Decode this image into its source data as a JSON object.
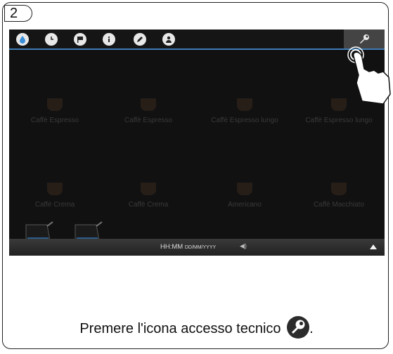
{
  "step": "2",
  "topbar": {
    "icons": [
      "water-drop-icon",
      "clock-icon",
      "flag-icon",
      "info-icon",
      "pencil-icon",
      "user-icon"
    ],
    "settings_icon": "wrench-icon",
    "accent_color": "#3e7fb8"
  },
  "drinks": [
    {
      "label": "Caffè Espresso"
    },
    {
      "label": "Caffè Espresso"
    },
    {
      "label": "Caffè Espresso lungo"
    },
    {
      "label": "Caffè Espresso lungo"
    },
    {
      "label": "Caffè Crema"
    },
    {
      "label": "Caffè Crema"
    },
    {
      "label": "Americano"
    },
    {
      "label": "Caffè Macchiato"
    }
  ],
  "statusbar": {
    "time": "HH:MM",
    "date": "DD/MM/YYYY",
    "speaker_icon": "speaker-icon",
    "up_icon": "arrow-up-icon"
  },
  "caption": {
    "text": "Premere l'icona accesso tecnico",
    "suffix": "."
  }
}
